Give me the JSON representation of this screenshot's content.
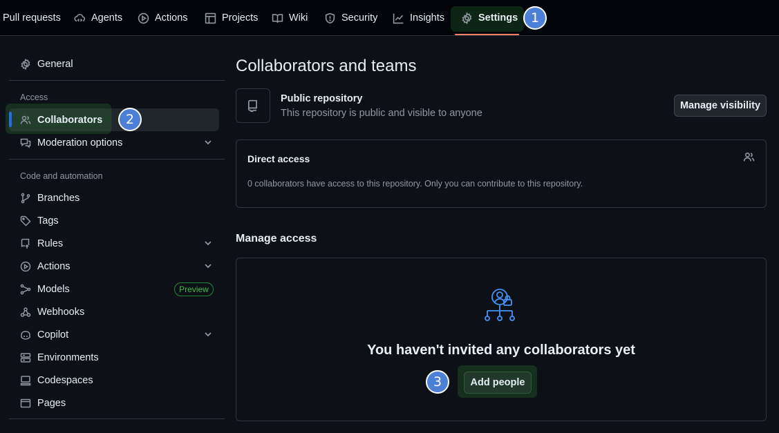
{
  "nav": {
    "tabs": [
      {
        "label": "Pull requests",
        "icon": "pull-request-icon"
      },
      {
        "label": "Agents",
        "icon": "agents-icon"
      },
      {
        "label": "Actions",
        "icon": "play-icon"
      },
      {
        "label": "Projects",
        "icon": "table-icon"
      },
      {
        "label": "Wiki",
        "icon": "book-icon"
      },
      {
        "label": "Security",
        "icon": "shield-icon"
      },
      {
        "label": "Insights",
        "icon": "graph-icon"
      },
      {
        "label": "Settings",
        "icon": "gear-icon",
        "selected": true
      }
    ]
  },
  "callouts": [
    "1",
    "2",
    "3"
  ],
  "sidebar": {
    "general": "General",
    "access_heading": "Access",
    "access_items": [
      {
        "label": "Collaborators",
        "selected": true
      },
      {
        "label": "Moderation options",
        "expandable": true
      }
    ],
    "code_heading": "Code and automation",
    "code_items": [
      {
        "label": "Branches"
      },
      {
        "label": "Tags"
      },
      {
        "label": "Rules",
        "expandable": true
      },
      {
        "label": "Actions",
        "expandable": true
      },
      {
        "label": "Models",
        "badge": "Preview"
      },
      {
        "label": "Webhooks"
      },
      {
        "label": "Copilot",
        "expandable": true
      },
      {
        "label": "Environments"
      },
      {
        "label": "Codespaces"
      },
      {
        "label": "Pages"
      }
    ]
  },
  "main": {
    "title": "Collaborators and teams",
    "visibility": {
      "title": "Public repository",
      "subtitle": "This repository is public and visible to anyone",
      "button": "Manage visibility"
    },
    "direct_access": {
      "title": "Direct access",
      "text": "0 collaborators have access to this repository. Only you can contribute to this repository."
    },
    "manage_access": {
      "title": "Manage access",
      "empty_title": "You haven't invited any collaborators yet",
      "button": "Add people"
    }
  },
  "colors": {
    "background": "#0d1117",
    "accent_underline": "#f78166",
    "selected_bar": "#1f6feb",
    "callout": "#4c7fd6",
    "highlight": "#2e7d32"
  }
}
